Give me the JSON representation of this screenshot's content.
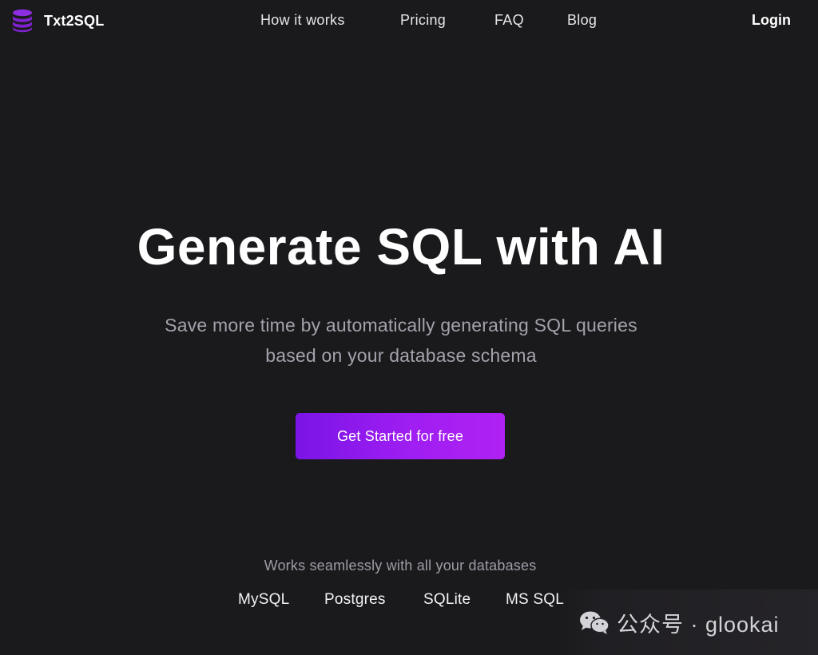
{
  "brand": {
    "name": "Txt2SQL",
    "icon": "database-icon",
    "accent_color": "#7e22ce"
  },
  "nav": {
    "items": [
      "How it works",
      "Pricing",
      "FAQ",
      "Blog"
    ],
    "login_label": "Login"
  },
  "hero": {
    "title": "Generate SQL with AI",
    "subtitle_line1": "Save more time by automatically generating SQL queries",
    "subtitle_line2": "based on your database schema",
    "cta_label": "Get Started for free",
    "cta_gradient": [
      "#7b14e6",
      "#b021f3"
    ]
  },
  "databases": {
    "caption": "Works seamlessly with all your databases",
    "items": [
      "MySQL",
      "Postgres",
      "SQLite",
      "MS SQL"
    ]
  },
  "watermark": {
    "icon": "wechat-icon",
    "text": "公众号 · glookai"
  },
  "colors": {
    "background": "#1a191c",
    "muted_text": "#a2a2ab"
  }
}
